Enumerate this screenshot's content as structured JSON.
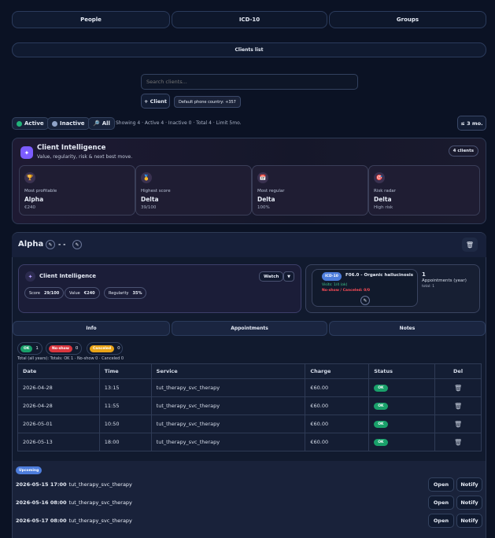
{
  "top_tabs": [
    "People",
    "ICD-10",
    "Groups"
  ],
  "sub_tab": "Clients list",
  "search": {
    "placeholder": "Search clients..."
  },
  "add_client": "+ Client",
  "phone_country": "Default phone country: +357",
  "filters": {
    "active": "Active",
    "inactive": "Inactive",
    "all": "All",
    "summary": "Showing 4 · Active 4 · Inactive 0 · Total 4 · Limit 5mo.",
    "range": "≤ 3 mo."
  },
  "intel": {
    "title": "Client Intelligence",
    "subtitle": "Value, regularity, risk & next best move.",
    "badge": "4 clients",
    "cards": [
      {
        "label": "Most profitable",
        "value": "Alpha",
        "sub": "€240"
      },
      {
        "label": "Highest score",
        "value": "Delta",
        "sub": "39/100"
      },
      {
        "label": "Most regular",
        "value": "Delta",
        "sub": "100%"
      },
      {
        "label": "Risk radar",
        "value": "Delta",
        "sub": "High risk"
      }
    ]
  },
  "client": {
    "name": "Alpha",
    "dash": "- -",
    "intel_title": "Client Intelligence",
    "watch": "Watch",
    "score_label": "Score",
    "score": "29/100",
    "value_label": "Value",
    "value": "€240",
    "reg_label": "Regularity",
    "reg": "35%",
    "icd_badge": "ICD-10",
    "icd_text": "F06.0 - Organic hallucinosis",
    "visits": "Visits: 1/4 (ok)",
    "noshow": "No-show / Canceled: 0/0",
    "appt_count": "1",
    "appt_label": "Appointments (year)",
    "appt_total": "total: 1"
  },
  "detail_tabs": [
    "Info",
    "Appointments",
    "Notes"
  ],
  "counts": {
    "ok_label": "OK",
    "ok": "1",
    "noshow_label": "No-show",
    "noshow": "0",
    "cancel_label": "Canceled",
    "cancel": "0",
    "total": "Total (all years): Totals: OK 1 · No-show 0 · Canceled 0"
  },
  "table": {
    "headers": [
      "Date",
      "Time",
      "Service",
      "Charge",
      "Status",
      "Del"
    ],
    "rows": [
      {
        "date": "2026-04-28",
        "time": "13:15",
        "service": "tut_therapy_svc_therapy",
        "charge": "€60.00",
        "status": "OK"
      },
      {
        "date": "2026-04-28",
        "time": "11:55",
        "service": "tut_therapy_svc_therapy",
        "charge": "€60.00",
        "status": "OK"
      },
      {
        "date": "2026-05-01",
        "time": "10:50",
        "service": "tut_therapy_svc_therapy",
        "charge": "€60.00",
        "status": "OK"
      },
      {
        "date": "2026-05-13",
        "time": "18:00",
        "service": "tut_therapy_svc_therapy",
        "charge": "€60.00",
        "status": "OK"
      }
    ]
  },
  "upcoming": {
    "badge": "Upcoming",
    "items": [
      {
        "when": "2026-05-15 17:00",
        "service": "tut_therapy_svc_therapy"
      },
      {
        "when": "2026-05-16 08:00",
        "service": "tut_therapy_svc_therapy"
      },
      {
        "when": "2026-05-17 08:00",
        "service": "tut_therapy_svc_therapy"
      }
    ],
    "open": "Open",
    "notify": "Notify"
  },
  "colors": {
    "bg": "#0b1224",
    "ok": "#19a06a",
    "noshow": "#d9363e",
    "canceled": "#e8a317",
    "icd": "#4d7ddc",
    "accent": "#7c5cff"
  }
}
